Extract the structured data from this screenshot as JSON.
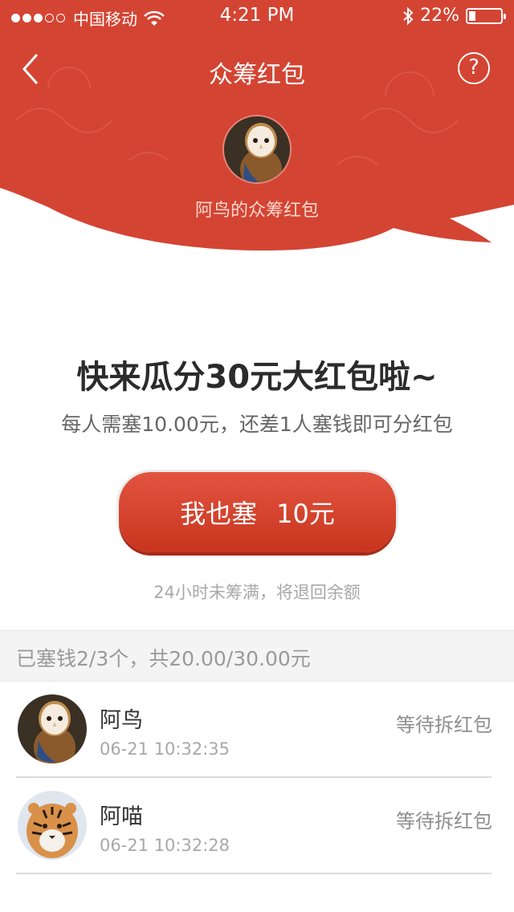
{
  "status_bar": {
    "carrier": "中国移动",
    "time": "4:21 PM",
    "battery_text": "22%",
    "battery_level": 0.22
  },
  "nav": {
    "title": "众筹红包",
    "help": "?"
  },
  "host": {
    "caption": "阿鸟的众筹红包"
  },
  "main": {
    "headline": "快来瓜分30元大红包啦~",
    "subline": "每人需塞10.00元，还差1人塞钱即可分红包",
    "button_action": "我也塞",
    "button_amount": "10元",
    "refund_note": "24小时未筹满，将退回余额"
  },
  "summary": {
    "text": "已塞钱2/3个，共20.00/30.00元"
  },
  "participants": [
    {
      "name": "阿鸟",
      "time": "06-21 10:32:35",
      "status": "等待拆红包"
    },
    {
      "name": "阿喵",
      "time": "06-21 10:32:28",
      "status": "等待拆红包"
    }
  ],
  "colors": {
    "brand_red": "#d44433",
    "button_red": "#d03e28"
  }
}
